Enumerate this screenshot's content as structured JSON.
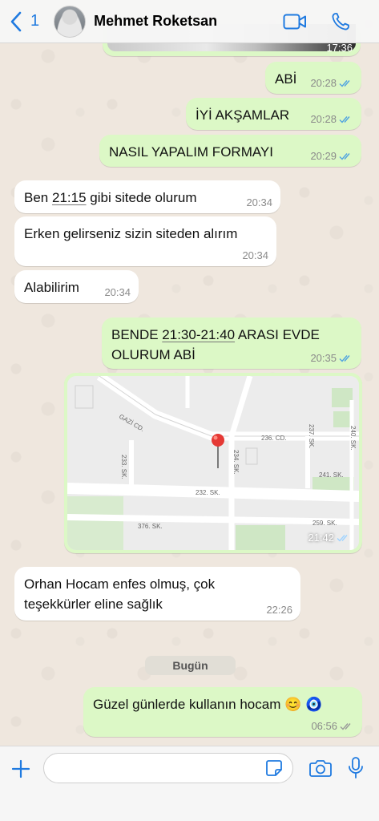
{
  "header": {
    "back_count": "1",
    "contact_name": "Mehmet Roketsan"
  },
  "messages": [
    {
      "text": "ABİ",
      "time": "20:28",
      "status": "read"
    },
    {
      "text": "İYİ AKŞAMLAR",
      "time": "20:28",
      "status": "read"
    },
    {
      "text": "NASIL YAPALIM FORMAYI",
      "time": "20:29",
      "status": "read"
    },
    {
      "text_pre": "Ben ",
      "text_link": "21:15",
      "text_post": " gibi sitede olurum",
      "time": "20:34"
    },
    {
      "text": "Erken gelirseniz sizin siteden alırım",
      "time": "20:34"
    },
    {
      "text": "Alabilirim",
      "time": "20:34"
    },
    {
      "line1_pre": "BENDE ",
      "line1_link": "21:30-21:40",
      "line1_post": " ARASI EVDE",
      "line2": "OLURUM ABİ",
      "time": "20:35",
      "status": "read"
    },
    {
      "line1": "Orhan Hocam enfes olmuş, çok",
      "line2": "teşekkürler eline sağlık",
      "time": "22:26"
    },
    {
      "text": "Güzel günlerde kullanın hocam 😊 🧿",
      "time": "06:56",
      "status": "sent"
    }
  ],
  "partial_top": {
    "time": "17:36"
  },
  "location": {
    "time": "21:42",
    "status": "read",
    "streets": [
      "GAZİ CD.",
      "236. CD.",
      "240. SK.",
      "237. SK.",
      "233. SK.",
      "234. SK.",
      "241. SK.",
      "232. SK.",
      "376. SK.",
      "259. SK."
    ]
  },
  "date_divider": "Bugün",
  "input": {
    "placeholder": ""
  },
  "colors": {
    "outgoing": "#dcf8c6",
    "incoming": "#ffffff",
    "accent": "#1f7ae0",
    "read_tick": "#4fa3e0"
  },
  "icons": [
    "chevron-left-icon",
    "video-call-icon",
    "phone-icon",
    "plus-icon",
    "sticker-icon",
    "camera-icon",
    "microphone-icon",
    "double-check-icon"
  ]
}
